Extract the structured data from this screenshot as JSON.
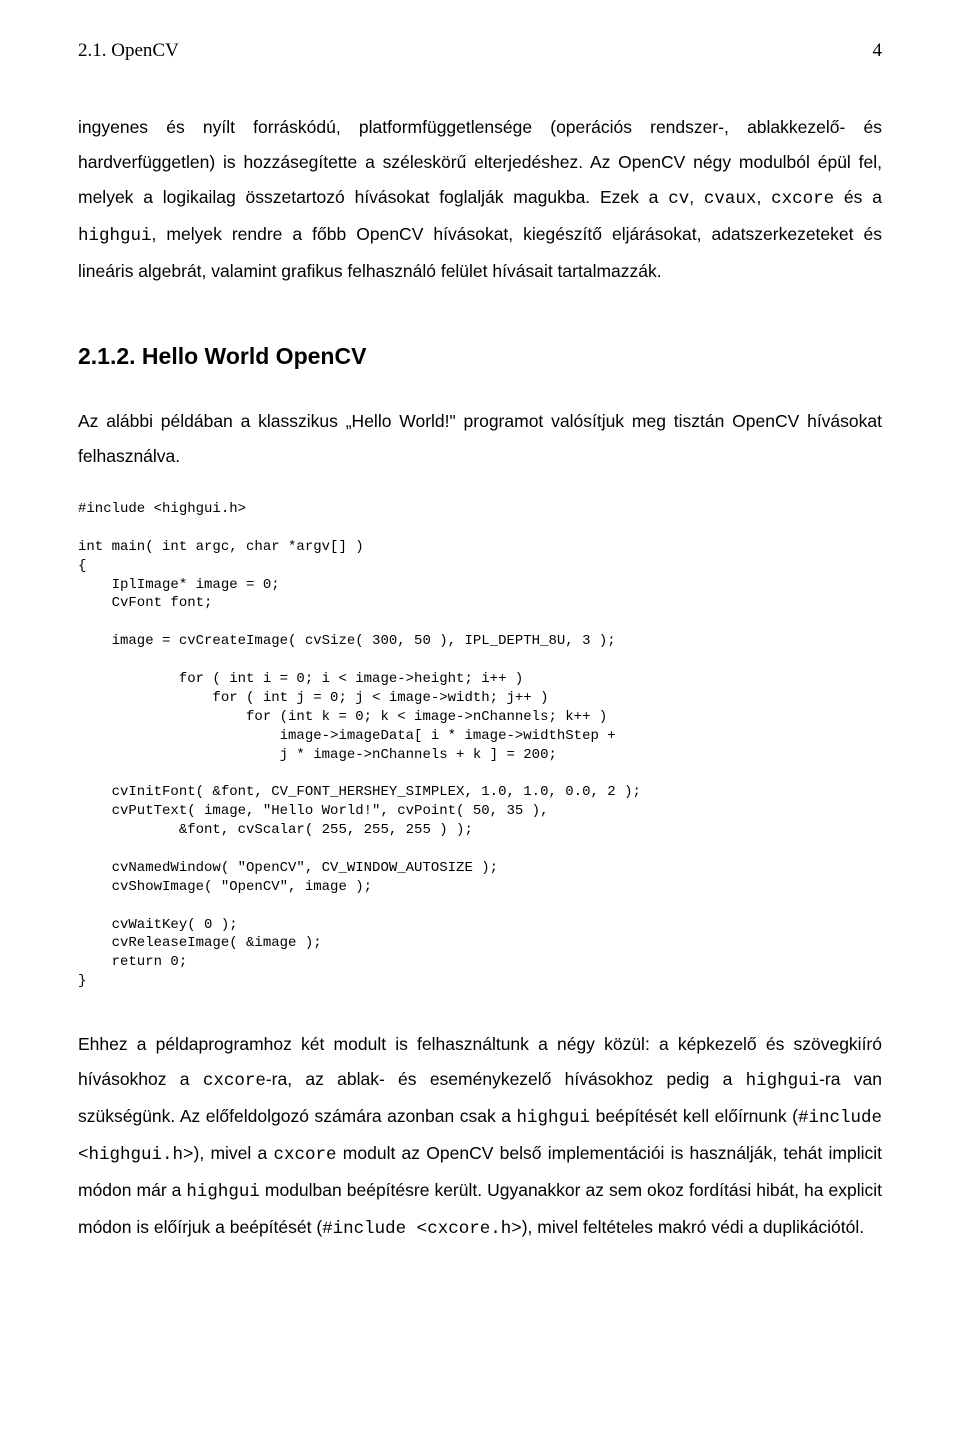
{
  "header": {
    "section_label": "2.1. OpenCV",
    "page_number": "4"
  },
  "para1": {
    "t1": "ingyenes és nyílt forráskódú, platformfüggetlensége (operációs rendszer-, ablakkezelő- és hardverfüggetlen) is hozzásegítette a széleskörű elterjedéshez. Az OpenCV négy modulból épül fel, melyek a logikailag összetartozó hívásokat foglalják magukba. Ezek a ",
    "c1": "cv",
    "t2": ", ",
    "c2": "cvaux",
    "t3": ", ",
    "c3": "cxcore",
    "t4": " és a ",
    "c4": "highgui",
    "t5": ", melyek rendre a főbb OpenCV hívásokat, kiegészítő eljárásokat, adatszerkezeteket és lineáris algebrát, valamint grafikus felhasználó felület hívásait tartalmazzák."
  },
  "heading": "2.1.2. Hello World OpenCV",
  "para2": "Az alábbi példában a klasszikus „Hello World!\" programot valósítjuk meg tisztán OpenCV hívásokat felhasználva.",
  "code": "#include <highgui.h>\n\nint main( int argc, char *argv[] )\n{\n    IplImage* image = 0;\n    CvFont font;\n\n    image = cvCreateImage( cvSize( 300, 50 ), IPL_DEPTH_8U, 3 );\n\n            for ( int i = 0; i < image->height; i++ )\n                for ( int j = 0; j < image->width; j++ )\n                    for (int k = 0; k < image->nChannels; k++ )\n                        image->imageData[ i * image->widthStep +\n                        j * image->nChannels + k ] = 200;\n\n    cvInitFont( &font, CV_FONT_HERSHEY_SIMPLEX, 1.0, 1.0, 0.0, 2 );\n    cvPutText( image, \"Hello World!\", cvPoint( 50, 35 ),\n            &font, cvScalar( 255, 255, 255 ) );\n\n    cvNamedWindow( \"OpenCV\", CV_WINDOW_AUTOSIZE );\n    cvShowImage( \"OpenCV\", image );\n\n    cvWaitKey( 0 );\n    cvReleaseImage( &image );\n    return 0;\n}",
  "para3": {
    "t1": "Ehhez a példaprogramhoz két modult is felhasználtunk a négy közül: a képkezelő és szövegkiíró hívásokhoz a ",
    "c1": "cxcore",
    "t2": "-ra, az ablak- és eseménykezelő hívásokhoz pedig a ",
    "c2": "highgui",
    "t3": "-ra van szükségünk. Az előfeldolgozó számára azonban csak a ",
    "c3": "highgui",
    "t4": " beépítését kell előírnunk (",
    "c4": "#include <highgui.h>",
    "t5": "), mivel a ",
    "c5": "cxcore",
    "t6": " modult az OpenCV belső implementációi is használják, tehát implicit módon már a ",
    "c6": "highgui",
    "t7": " modulban beépítésre került. Ugyanakkor az sem okoz fordítási hibát, ha explicit módon is előírjuk a beépítését (",
    "c7": "#include <cxcore.h>",
    "t8": "), mivel feltételes makró védi a duplikációtól."
  }
}
